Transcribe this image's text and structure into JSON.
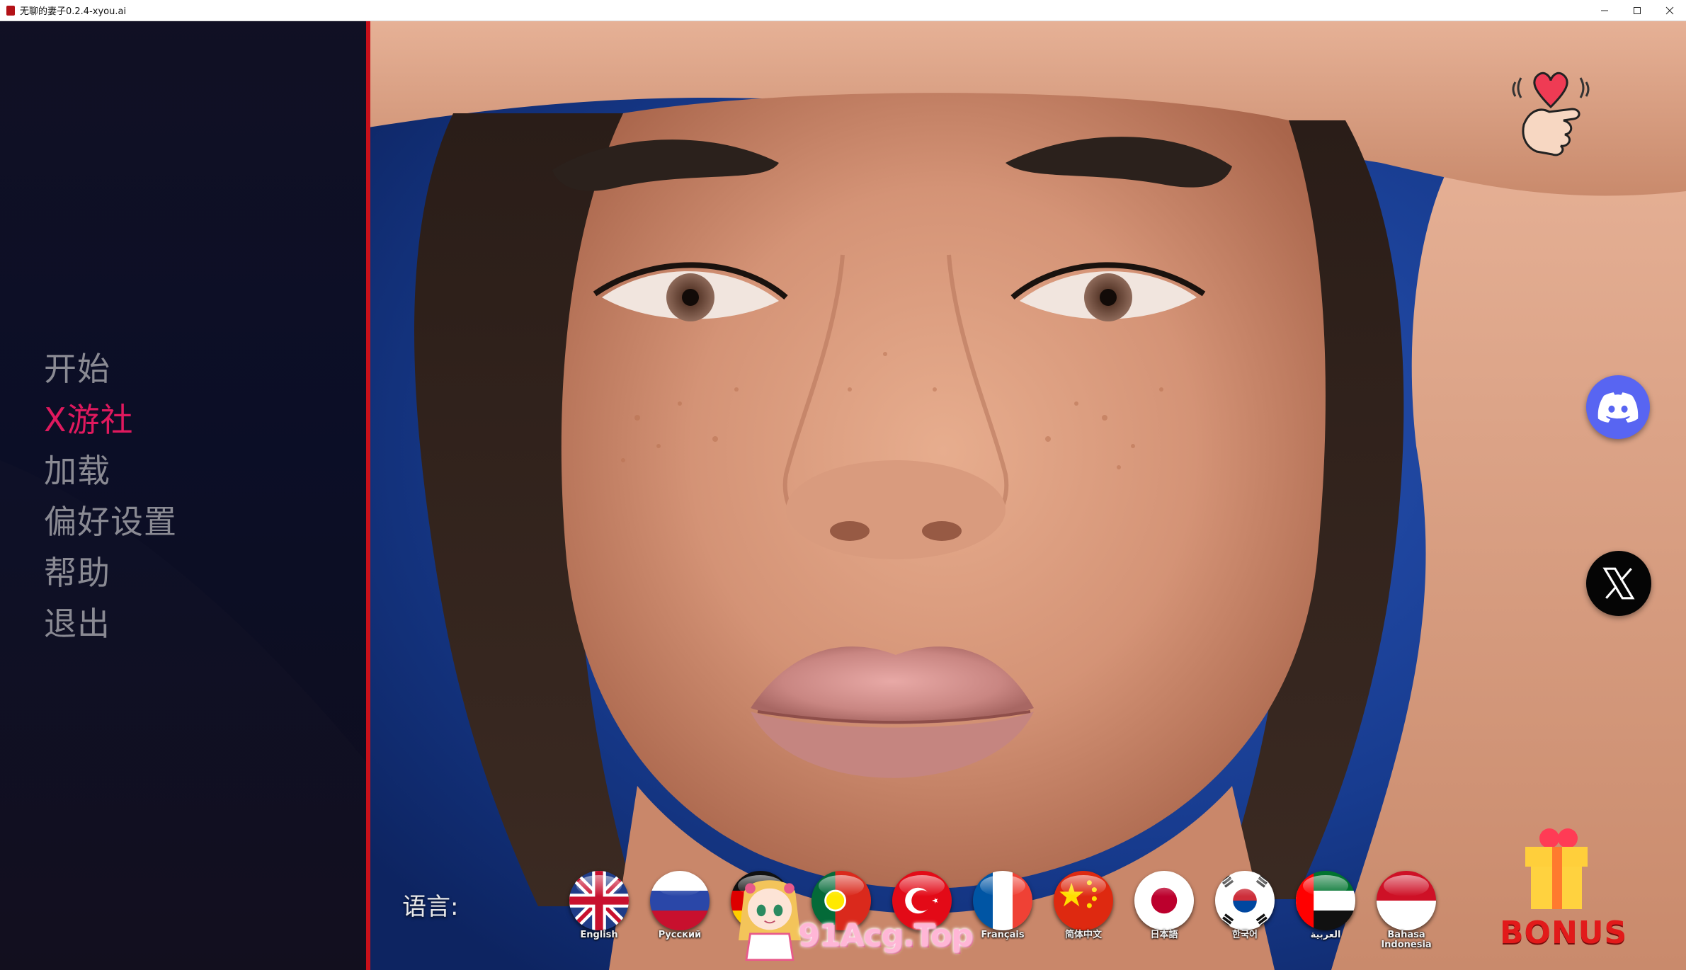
{
  "window": {
    "title": "无聊的妻子0.2.4-xyou.ai",
    "controls": [
      "minimize-icon",
      "maximize-icon",
      "close-icon"
    ]
  },
  "menu": {
    "items": [
      {
        "label": "开始"
      },
      {
        "label": "X游社"
      },
      {
        "label": "加载"
      },
      {
        "label": "偏好设置"
      },
      {
        "label": "帮助"
      },
      {
        "label": "退出"
      }
    ],
    "active_index": 1,
    "active_color": "#e0195e",
    "inactive_color": "#8a8a93",
    "accent_border": "#c8101a"
  },
  "language": {
    "label": "语言:",
    "flags": [
      {
        "name": "English",
        "icon": "uk-flag-icon"
      },
      {
        "name": "Русский",
        "icon": "russia-flag-icon"
      },
      {
        "name": "",
        "icon": "germany-flag-icon"
      },
      {
        "name": "",
        "icon": "portugal-flag-icon"
      },
      {
        "name": "",
        "icon": "turkey-flag-icon"
      },
      {
        "name": "Français",
        "icon": "france-flag-icon"
      },
      {
        "name": "简体中文",
        "icon": "china-flag-icon"
      },
      {
        "name": "日本語",
        "icon": "japan-flag-icon"
      },
      {
        "name": "한국어",
        "icon": "korea-flag-icon"
      },
      {
        "name": "العربية",
        "icon": "uae-flag-icon"
      },
      {
        "name": "Bahasa Indonesia",
        "icon": "indonesia-flag-icon"
      }
    ]
  },
  "side_icons": {
    "heart": "heart-hand-icon",
    "discord": "discord-icon",
    "x": "x-logo-icon",
    "discord_color": "#5865f2"
  },
  "bonus": {
    "label": "BONUS",
    "color": "#e21a1a"
  },
  "watermark": {
    "text": "91Acg.Top"
  }
}
